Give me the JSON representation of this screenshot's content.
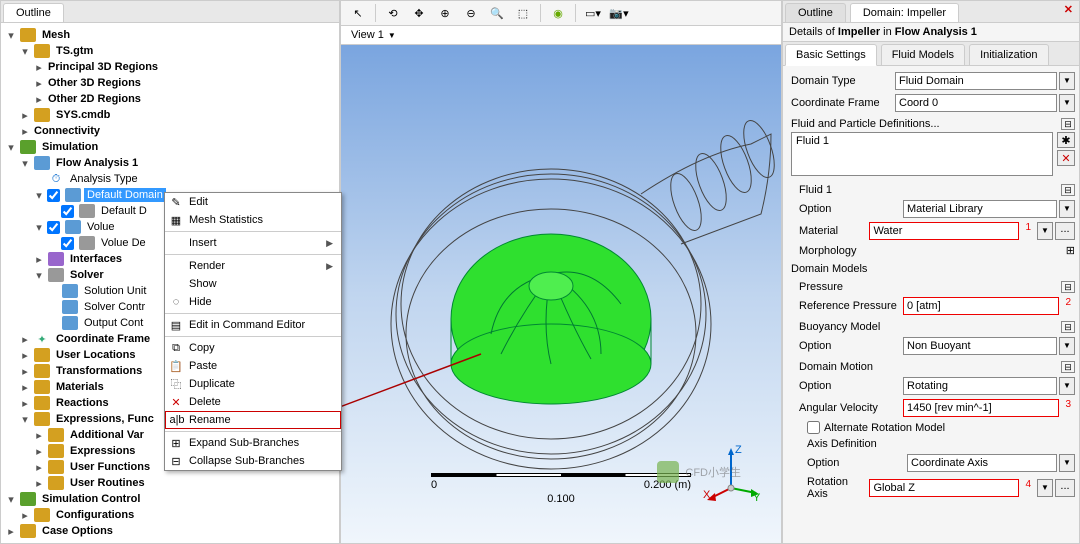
{
  "leftPanel": {
    "tab": "Outline",
    "tree": {
      "mesh": "Mesh",
      "tsgtm": "TS.gtm",
      "p3d": "Principal 3D Regions",
      "o3d": "Other 3D Regions",
      "o2d": "Other 2D Regions",
      "syscmdb": "SYS.cmdb",
      "conn": "Connectivity",
      "sim": "Simulation",
      "flow": "Flow Analysis 1",
      "atype": "Analysis Type",
      "ddomain": "Default Domain",
      "ddeflt": "Default D",
      "volue": "Volue",
      "volueDe": "Volue De",
      "ifaces": "Interfaces",
      "solver": "Solver",
      "sunit": "Solution Unit",
      "scontrol": "Solver Contr",
      "ocont": "Output Cont",
      "cframe": "Coordinate Frame",
      "uloc": "User Locations",
      "trans": "Transformations",
      "mat": "Materials",
      "react": "Reactions",
      "expr": "Expressions, Func",
      "addvar": "Additional Var",
      "expr2": "Expressions",
      "ufunc": "User Functions",
      "urout": "User Routines",
      "simctrl": "Simulation Control",
      "config": "Configurations",
      "caseopt": "Case Options"
    }
  },
  "contextMenu": {
    "edit": "Edit",
    "meshStats": "Mesh Statistics",
    "insert": "Insert",
    "render": "Render",
    "show": "Show",
    "hide": "Hide",
    "editCmd": "Edit in Command Editor",
    "copy": "Copy",
    "paste": "Paste",
    "dup": "Duplicate",
    "del": "Delete",
    "rename": "Rename",
    "expand": "Expand Sub-Branches",
    "collapse": "Collapse Sub-Branches"
  },
  "center": {
    "viewTab": "View 1",
    "scale0": "0",
    "scale1": "0.200 (m)",
    "scaleMid": "0.100",
    "axisX": "X",
    "axisY": "Y",
    "axisZ": "Z"
  },
  "right": {
    "tabOutline": "Outline",
    "tabDomain": "Domain: Impeller",
    "detailsOf": "Details of",
    "impeller": "Impeller",
    "inText": "in",
    "flowAn": "Flow Analysis 1",
    "tabBasic": "Basic Settings",
    "tabFluid": "Fluid Models",
    "tabInit": "Initialization",
    "domainType": "Domain Type",
    "domainTypeVal": "Fluid Domain",
    "coordFrame": "Coordinate Frame",
    "coordFrameVal": "Coord 0",
    "fluidDefs": "Fluid and Particle Definitions...",
    "fluid1": "Fluid 1",
    "option": "Option",
    "matlib": "Material Library",
    "material": "Material",
    "materialVal": "Water",
    "morph": "Morphology",
    "domainModels": "Domain Models",
    "pressure": "Pressure",
    "refPressure": "Reference Pressure",
    "refPressureVal": "0 [atm]",
    "buoy": "Buoyancy Model",
    "nonBuoy": "Non Buoyant",
    "domMotion": "Domain Motion",
    "rotating": "Rotating",
    "angVel": "Angular Velocity",
    "angVelVal": "1450 [rev min^-1]",
    "altRot": "Alternate Rotation Model",
    "axisDef": "Axis Definition",
    "coordAxis": "Coordinate Axis",
    "rotAxis": "Rotation Axis",
    "rotAxisVal": "Global Z",
    "anno1": "1",
    "anno2": "2",
    "anno3": "3",
    "anno4": "4"
  },
  "watermark": "CFD小学生"
}
